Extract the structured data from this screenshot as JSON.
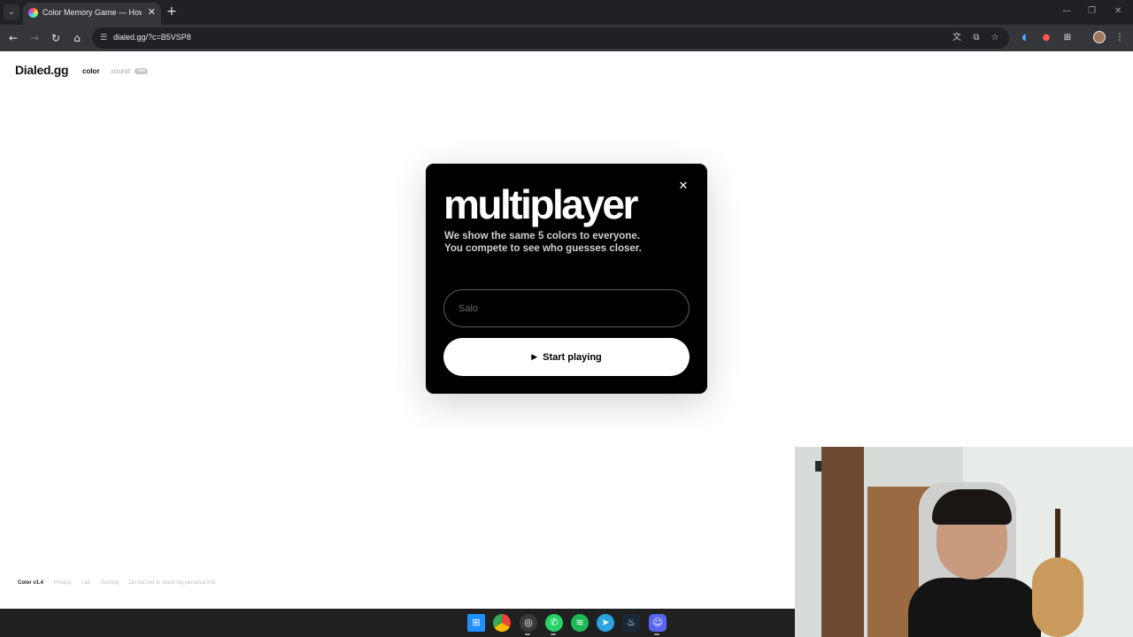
{
  "browser": {
    "tab_title": "Color Memory Game — How Well Can You See Color?",
    "tab_close": "✕",
    "new_tab": "+",
    "url": "dialed.gg/?c=B5VSP8",
    "tab_menu_icon": "chevron-down-icon",
    "minimize": "—",
    "restore": "❐",
    "close": "✕"
  },
  "page": {
    "logo": "Dialed.gg",
    "nav": {
      "color_label": "color",
      "sound_label": "sound",
      "new_badge": "new"
    },
    "footer": {
      "version": "Color v1.4",
      "links": [
        "Privacy",
        "Lab",
        "Scoring",
        "Do not sell or share my personal info"
      ]
    }
  },
  "modal": {
    "title": "multiplayer",
    "description_line1": "We show the same 5 colors to everyone.",
    "description_line2": "You compete to see who guesses closer.",
    "name_placeholder": "Salo",
    "start_label": "Start playing",
    "close_icon": "close-icon",
    "play_icon": "play-icon"
  },
  "taskbar": {
    "icons": [
      "windows-start-icon",
      "chrome-icon",
      "obs-icon",
      "whatsapp-icon",
      "spotify-icon",
      "telegram-icon",
      "steam-icon",
      "discord-icon"
    ]
  },
  "colors": {
    "modal_bg": "#000000",
    "button_bg": "#ffffff",
    "chrome_dark": "#202124",
    "toolbar": "#35363a"
  }
}
